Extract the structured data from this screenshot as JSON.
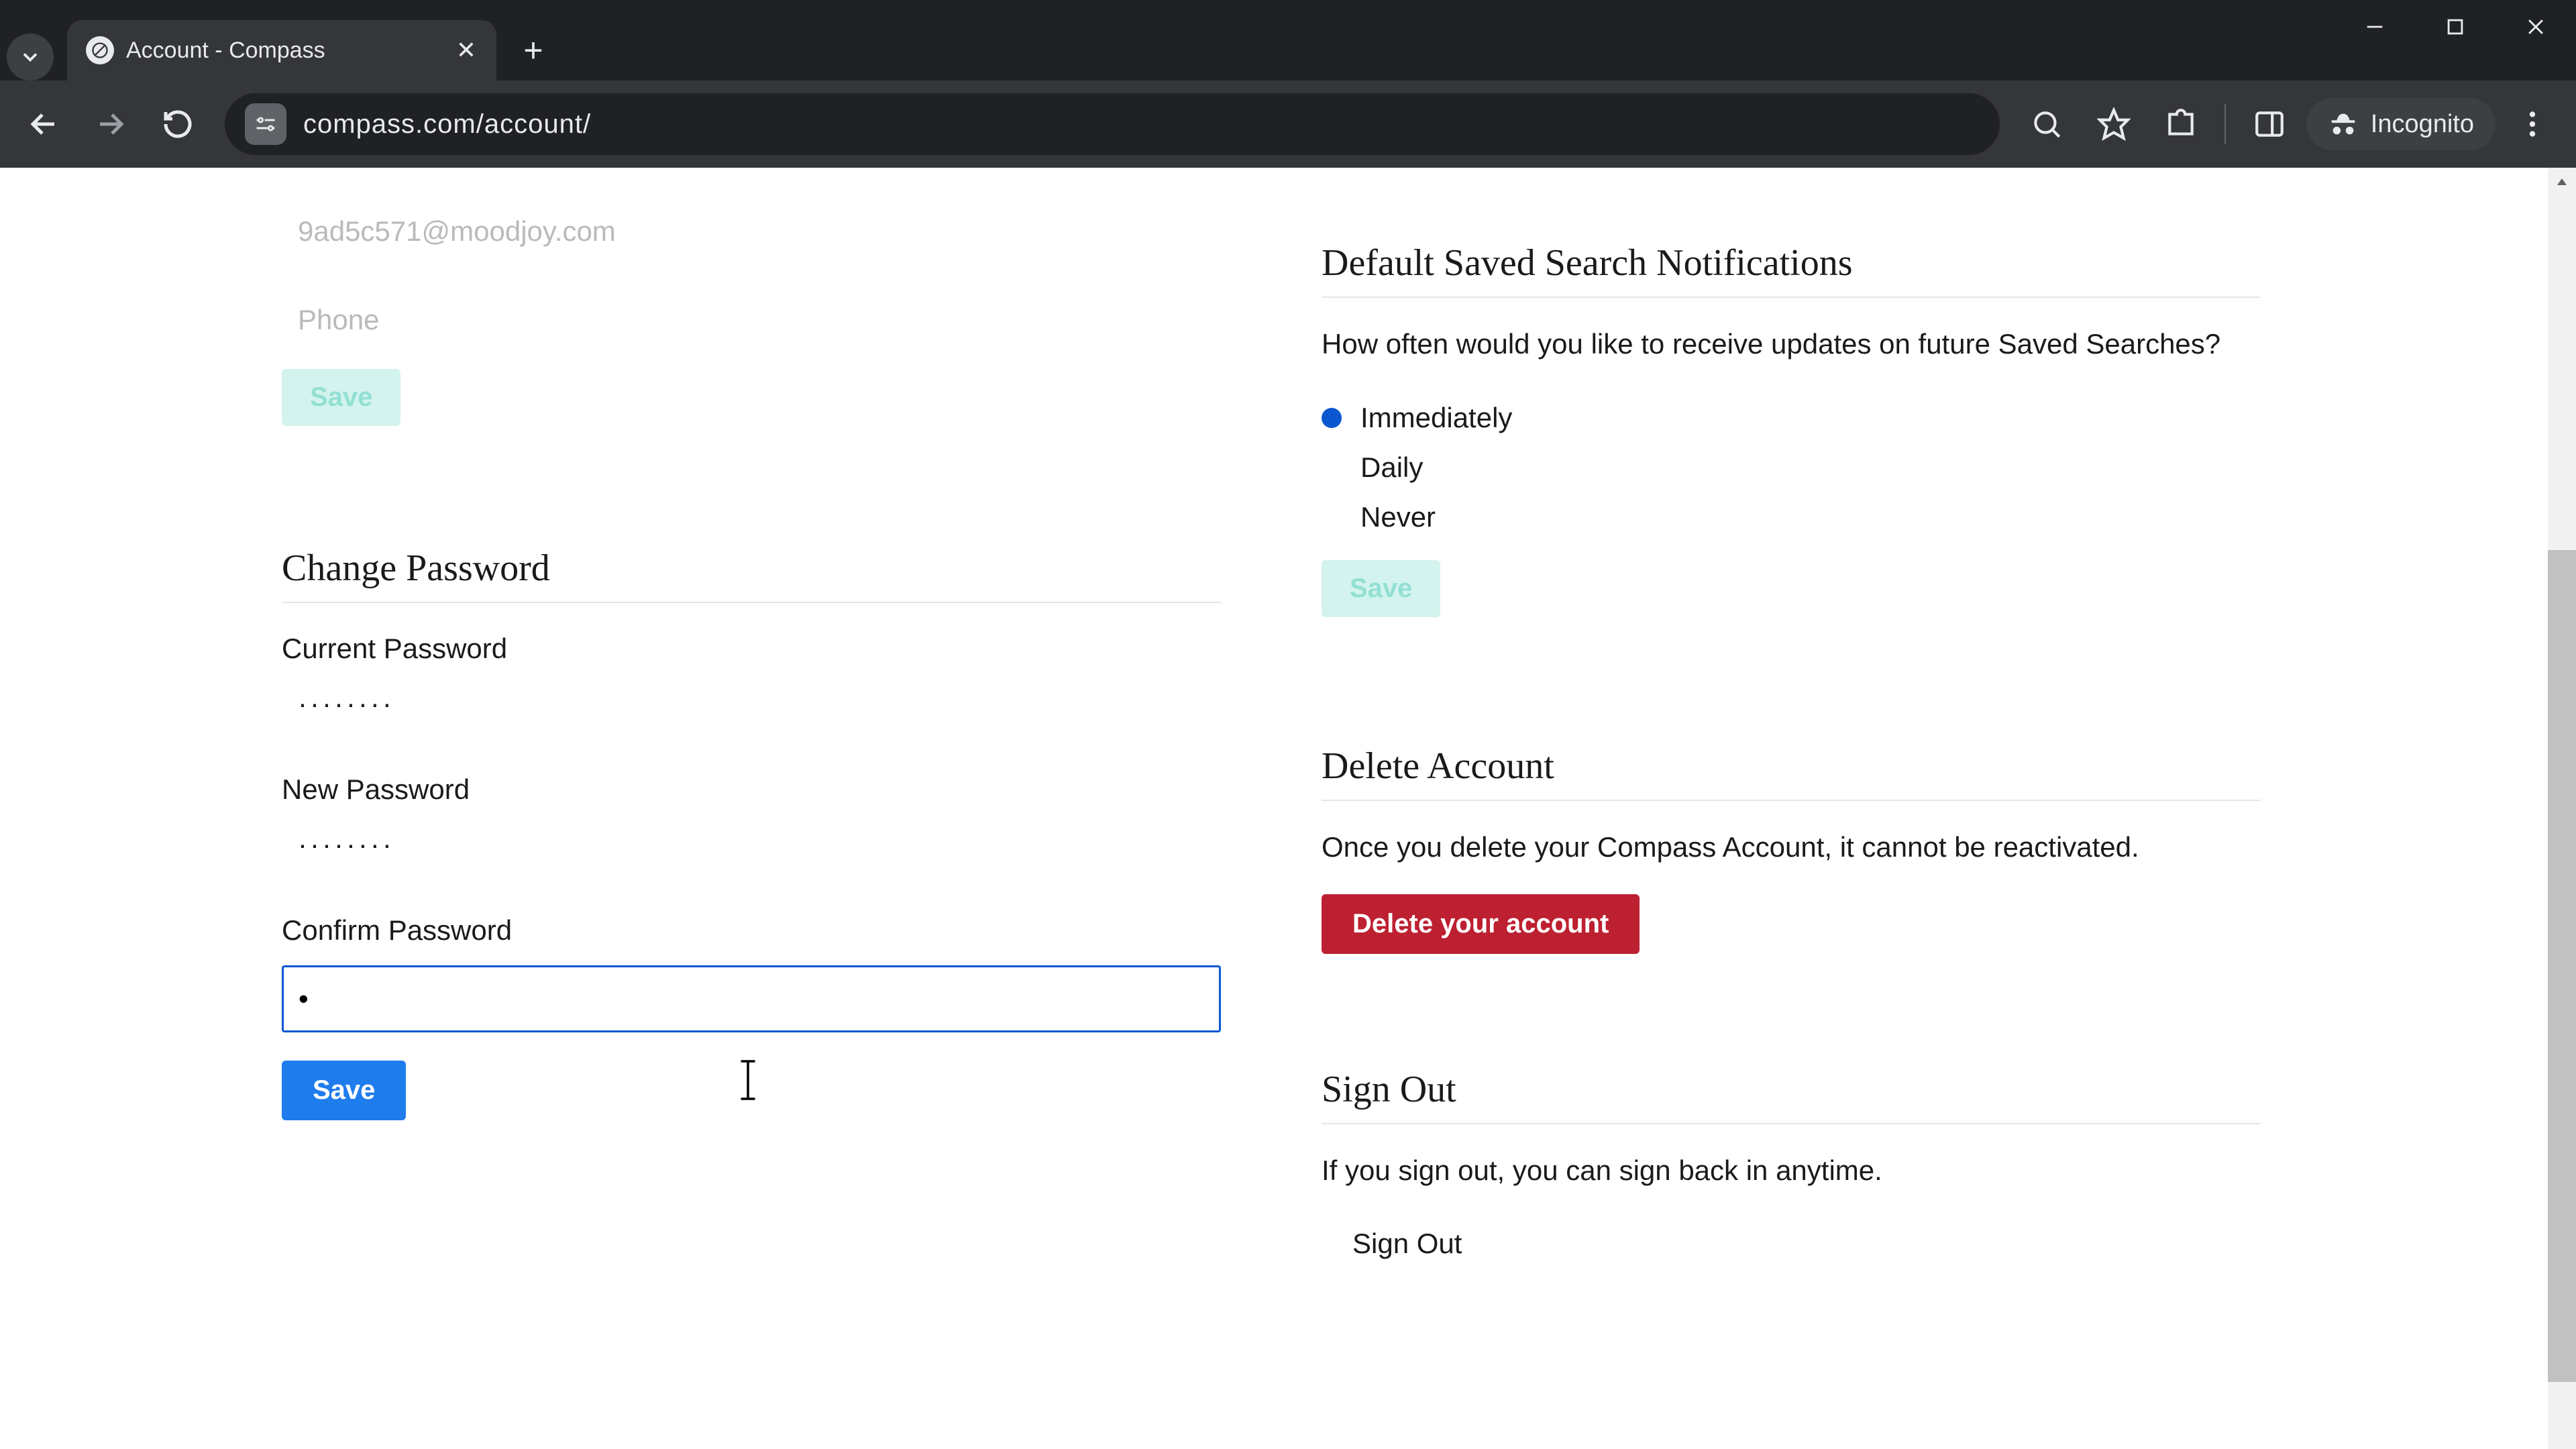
{
  "browser": {
    "tab_title": "Account - Compass",
    "url": "compass.com/account/",
    "incognito_label": "Incognito"
  },
  "left": {
    "email": "9ad5c571@moodjoy.com",
    "phone_placeholder": "Phone",
    "save_ghost": "Save",
    "change_password_title": "Change Password",
    "current_label": "Current Password",
    "current_value": "········",
    "new_label": "New Password",
    "new_value": "········",
    "confirm_label": "Confirm Password",
    "confirm_value": "·",
    "save_btn": "Save"
  },
  "right": {
    "saved_search_title": "Default Saved Search Notifications",
    "saved_search_body": "How often would you like to receive updates on future Saved Searches?",
    "opt_immediately": "Immediately",
    "opt_daily": "Daily",
    "opt_never": "Never",
    "saved_search_save": "Save",
    "delete_title": "Delete Account",
    "delete_body": "Once you delete your Compass Account, it cannot be reactivated.",
    "delete_btn": "Delete your account",
    "signout_title": "Sign Out",
    "signout_body": "If you sign out, you can sign back in anytime.",
    "signout_btn": "Sign Out"
  }
}
